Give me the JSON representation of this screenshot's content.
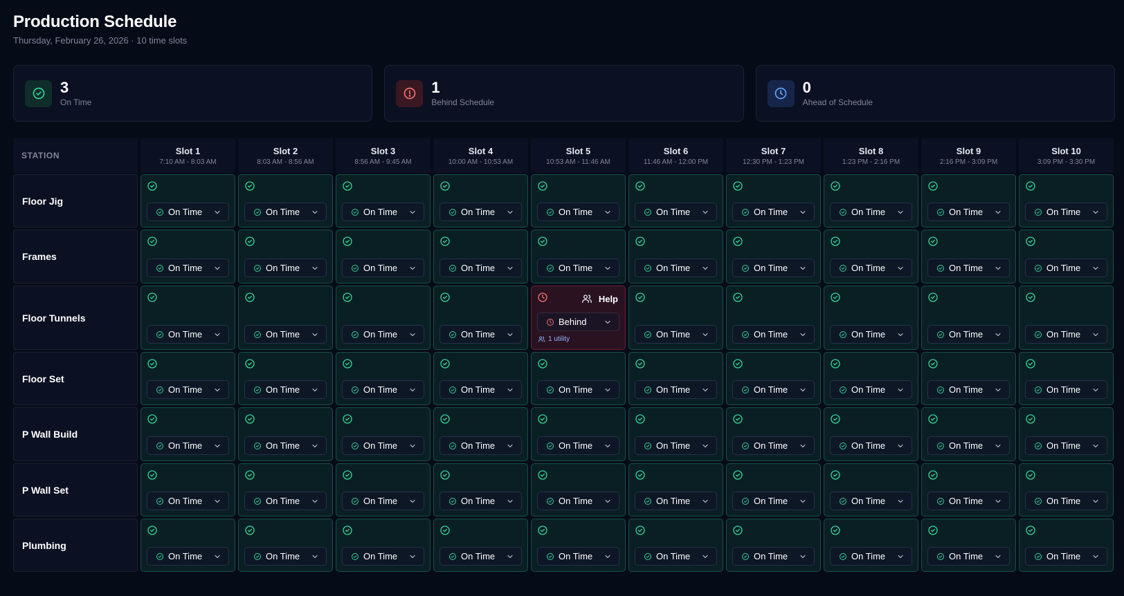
{
  "header": {
    "title": "Production Schedule",
    "subtitle": "Thursday, February 26, 2026 · 10 time slots"
  },
  "stats": [
    {
      "value": "3",
      "label": "On Time",
      "icon": "check-circle-icon",
      "tone": "green"
    },
    {
      "value": "1",
      "label": "Behind Schedule",
      "icon": "alert-circle-icon",
      "tone": "red"
    },
    {
      "value": "0",
      "label": "Ahead of Schedule",
      "icon": "clock-icon",
      "tone": "blue"
    }
  ],
  "colors": {
    "on_time": "#34d399",
    "behind": "#f87171",
    "ahead": "#60a5fa"
  },
  "grid": {
    "station_header": "STATION",
    "slots": [
      {
        "name": "Slot 1",
        "time": "7:10 AM - 8:03 AM"
      },
      {
        "name": "Slot 2",
        "time": "8:03 AM - 8:56 AM"
      },
      {
        "name": "Slot 3",
        "time": "8:56 AM - 9:45 AM"
      },
      {
        "name": "Slot 4",
        "time": "10:00 AM - 10:53 AM"
      },
      {
        "name": "Slot 5",
        "time": "10:53 AM - 11:46 AM"
      },
      {
        "name": "Slot 6",
        "time": "11:46 AM - 12:00 PM"
      },
      {
        "name": "Slot 7",
        "time": "12:30 PM - 1:23 PM"
      },
      {
        "name": "Slot 8",
        "time": "1:23 PM - 2:16 PM"
      },
      {
        "name": "Slot 9",
        "time": "2:16 PM - 3:09 PM"
      },
      {
        "name": "Slot 10",
        "time": "3:09 PM - 3:30 PM"
      }
    ],
    "stations": [
      {
        "name": "Floor Jig",
        "cells": [
          "On Time",
          "On Time",
          "On Time",
          "On Time",
          "On Time",
          "On Time",
          "On Time",
          "On Time",
          "On Time",
          "On Time"
        ]
      },
      {
        "name": "Frames",
        "cells": [
          "On Time",
          "On Time",
          "On Time",
          "On Time",
          "On Time",
          "On Time",
          "On Time",
          "On Time",
          "On Time",
          "On Time"
        ]
      },
      {
        "name": "Floor Tunnels",
        "cells": [
          "On Time",
          "On Time",
          "On Time",
          "On Time",
          "Behind",
          "On Time",
          "On Time",
          "On Time",
          "On Time",
          "On Time"
        ]
      },
      {
        "name": "Floor Set",
        "cells": [
          "On Time",
          "On Time",
          "On Time",
          "On Time",
          "On Time",
          "On Time",
          "On Time",
          "On Time",
          "On Time",
          "On Time"
        ]
      },
      {
        "name": "P Wall Build",
        "cells": [
          "On Time",
          "On Time",
          "On Time",
          "On Time",
          "On Time",
          "On Time",
          "On Time",
          "On Time",
          "On Time",
          "On Time"
        ]
      },
      {
        "name": "P Wall Set",
        "cells": [
          "On Time",
          "On Time",
          "On Time",
          "On Time",
          "On Time",
          "On Time",
          "On Time",
          "On Time",
          "On Time",
          "On Time"
        ]
      },
      {
        "name": "Plumbing",
        "cells": [
          "On Time",
          "On Time",
          "On Time",
          "On Time",
          "On Time",
          "On Time",
          "On Time",
          "On Time",
          "On Time",
          "On Time"
        ]
      }
    ],
    "behind_cell": {
      "help_label": "Help",
      "utility_label": "1 utility"
    }
  }
}
